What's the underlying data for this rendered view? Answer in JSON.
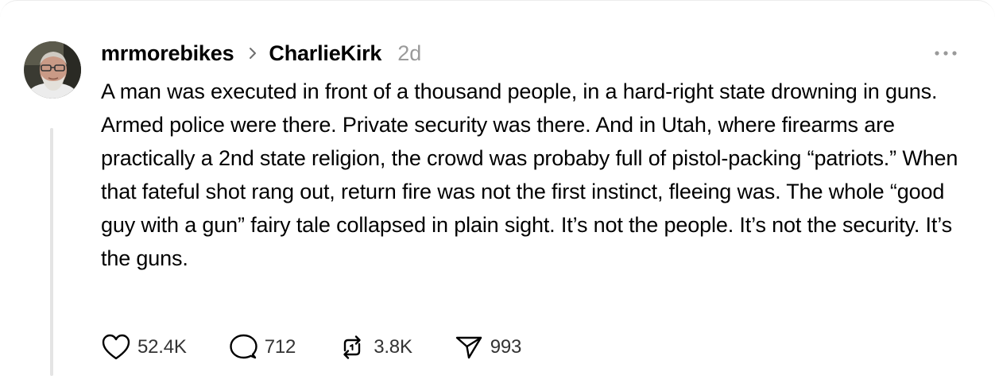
{
  "post": {
    "username": "mrmorebikes",
    "community": "CharlieKirk",
    "time": "2d",
    "text": "A man was executed in front of a thousand people, in a hard-right state drowning in guns. Armed police were there. Private security was there. And in Utah, where firearms are practically a 2nd state religion, the crowd was probaby full of pistol-packing “patriots.” When that fateful shot rang out, return fire was not the first instinct, fleeing was. The whole “good guy with a gun” fairy tale collapsed in plain sight. It’s not the people. It’s not the security. It’s the guns."
  },
  "actions": {
    "likes": "52.4K",
    "comments": "712",
    "reposts": "3.8K",
    "shares": "993"
  },
  "icons": {
    "chevron": "chevron-right-icon",
    "more": "more-horizontal-icon",
    "like": "heart-icon",
    "comment": "comment-bubble-icon",
    "repost": "repost-icon",
    "share": "send-icon"
  },
  "colors": {
    "text": "#000000",
    "secondary": "#9a9a9a",
    "icon": "#000000",
    "thread_line": "#e4e4e4"
  }
}
